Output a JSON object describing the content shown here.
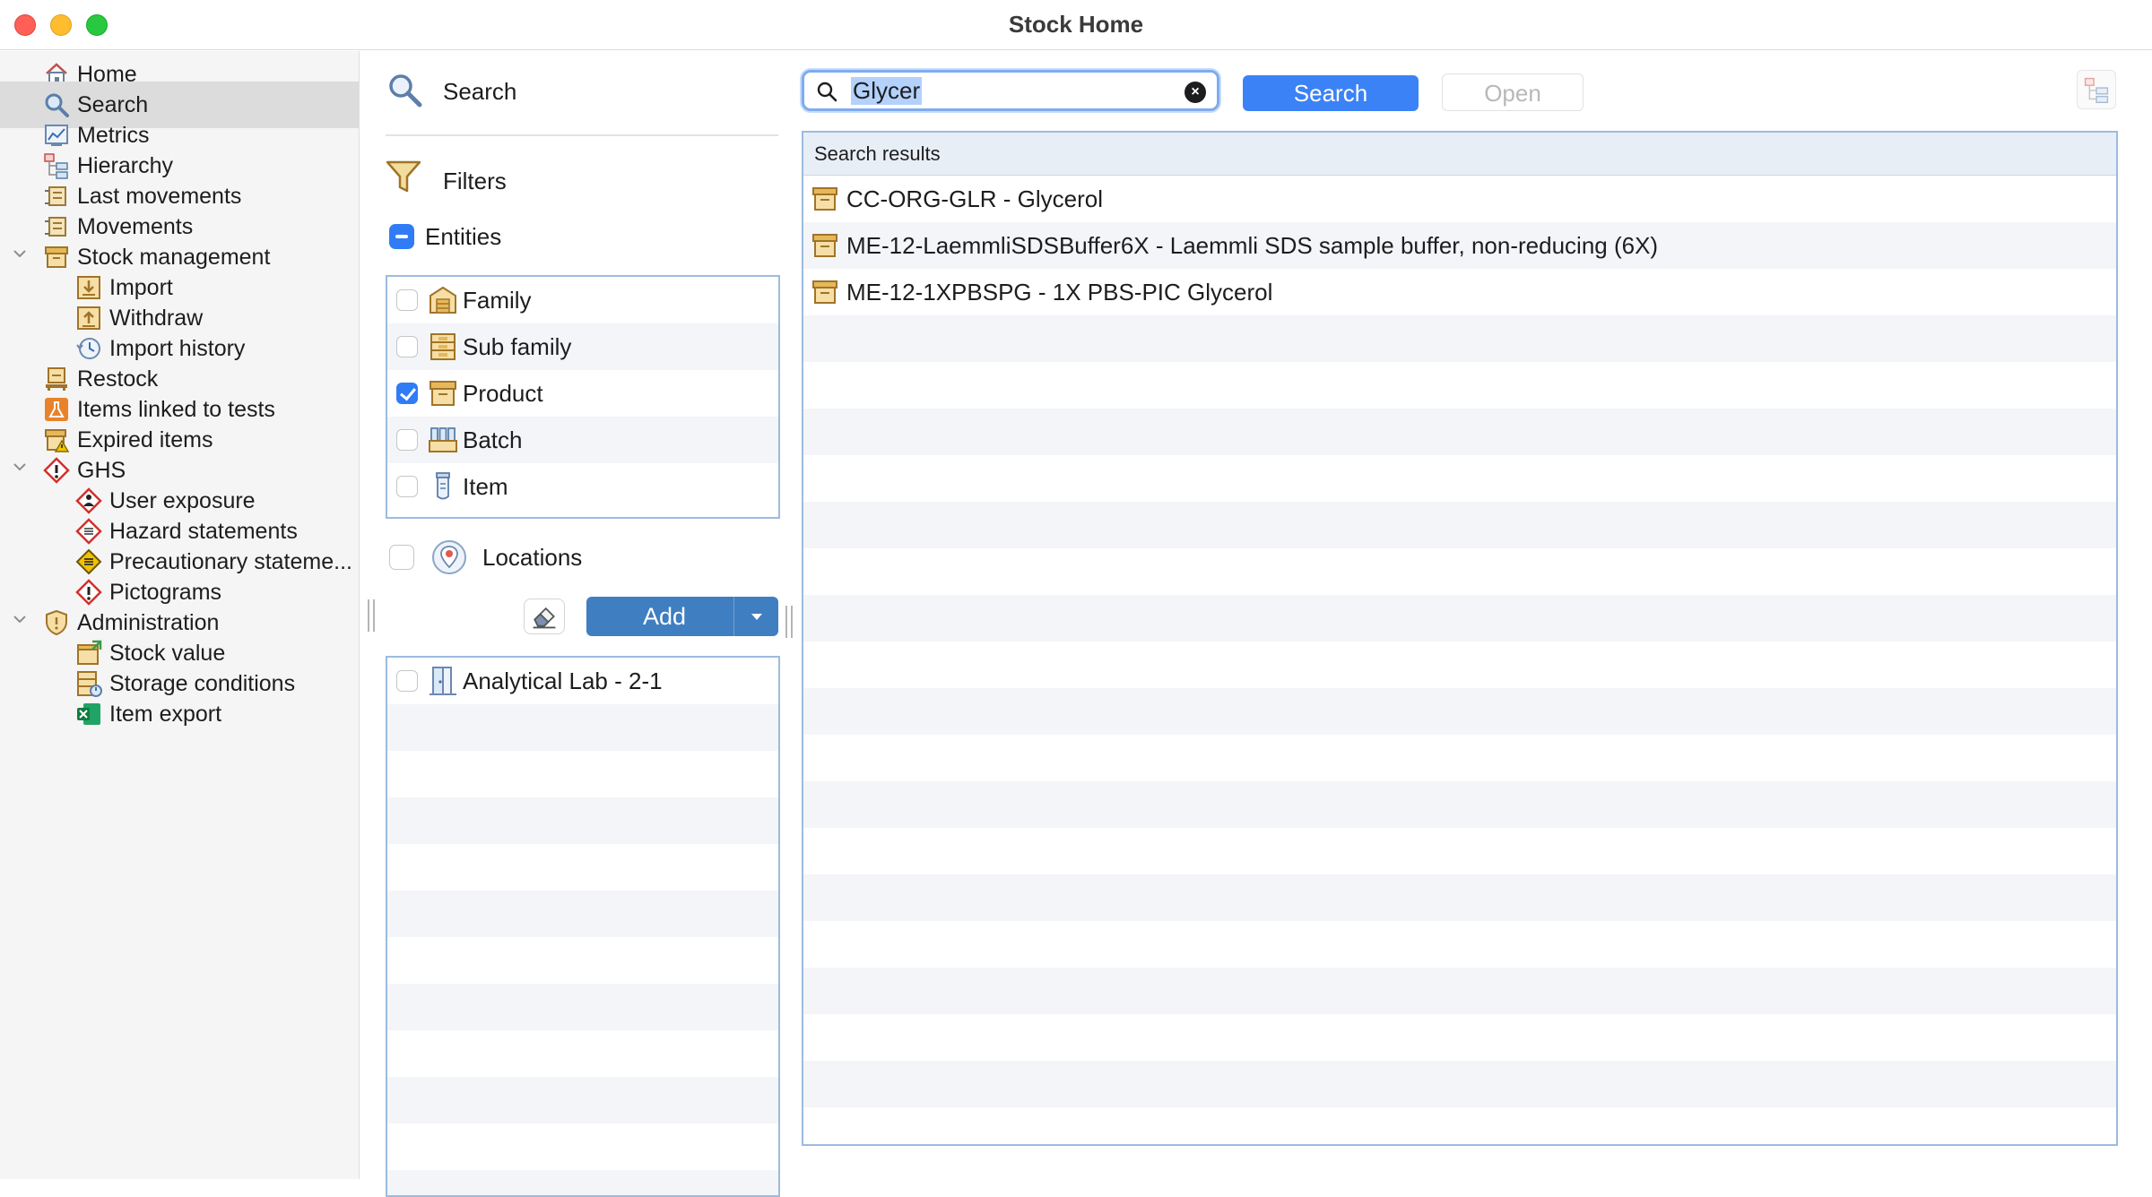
{
  "window": {
    "title": "Stock Home"
  },
  "sidebar": {
    "items": [
      {
        "label": "Home",
        "icon": "home-icon",
        "level": 0
      },
      {
        "label": "Search",
        "icon": "search-icon",
        "level": 0,
        "selected": true
      },
      {
        "label": "Metrics",
        "icon": "metrics-icon",
        "level": 0
      },
      {
        "label": "Hierarchy",
        "icon": "hierarchy-icon",
        "level": 0
      },
      {
        "label": "Last movements",
        "icon": "movements-icon",
        "level": 0
      },
      {
        "label": "Movements",
        "icon": "movements-icon",
        "level": 0
      },
      {
        "label": "Stock management",
        "icon": "box-icon",
        "level": 0,
        "expanded": true
      },
      {
        "label": "Import",
        "icon": "import-icon",
        "level": 1
      },
      {
        "label": "Withdraw",
        "icon": "withdraw-icon",
        "level": 1
      },
      {
        "label": "Import history",
        "icon": "history-icon",
        "level": 1
      },
      {
        "label": "Restock",
        "icon": "restock-icon",
        "level": 0
      },
      {
        "label": "Items linked to tests",
        "icon": "flask-icon",
        "level": 0
      },
      {
        "label": "Expired items",
        "icon": "expired-icon",
        "level": 0
      },
      {
        "label": "GHS",
        "icon": "ghs-icon",
        "level": 0,
        "expanded": true
      },
      {
        "label": "User exposure",
        "icon": "exposure-icon",
        "level": 1
      },
      {
        "label": "Hazard statements",
        "icon": "hazard-icon",
        "level": 1
      },
      {
        "label": "Precautionary stateme...",
        "icon": "precaution-icon",
        "level": 1
      },
      {
        "label": "Pictograms",
        "icon": "pictogram-icon",
        "level": 1
      },
      {
        "label": "Administration",
        "icon": "shield-icon",
        "level": 0,
        "expanded": true
      },
      {
        "label": "Stock value",
        "icon": "stock-value-icon",
        "level": 1
      },
      {
        "label": "Storage conditions",
        "icon": "storage-icon",
        "level": 1
      },
      {
        "label": "Item export",
        "icon": "excel-icon",
        "level": 1
      }
    ]
  },
  "filters": {
    "search_label": "Search",
    "filters_label": "Filters",
    "entities_label": "Entities",
    "entities": [
      {
        "label": "Family",
        "checked": false,
        "icon": "family-icon"
      },
      {
        "label": "Sub family",
        "checked": false,
        "icon": "sub-family-icon"
      },
      {
        "label": "Product",
        "checked": true,
        "icon": "product-icon"
      },
      {
        "label": "Batch",
        "checked": false,
        "icon": "batch-icon"
      },
      {
        "label": "Item",
        "checked": false,
        "icon": "item-icon"
      }
    ],
    "locations_label": "Locations",
    "add_label": "Add",
    "locations": [
      {
        "label": "Analytical Lab - 2-1",
        "checked": false,
        "icon": "door-icon"
      }
    ]
  },
  "toolbar": {
    "search_value": "Glycer",
    "search_button": "Search",
    "open_button": "Open"
  },
  "results": {
    "header": "Search results",
    "rows": [
      "CC-ORG-GLR - Glycerol",
      "ME-12-LaemmliSDSBuffer6X - Laemmli SDS sample buffer, non-reducing (6X)",
      "ME-12-1XPBSPG - 1X PBS-PIC Glycerol"
    ]
  },
  "colors": {
    "accent": "#3b82f6",
    "add_button": "#3f7ec0",
    "selection": "#dcdcdc",
    "box_icon": "#d9a441"
  }
}
